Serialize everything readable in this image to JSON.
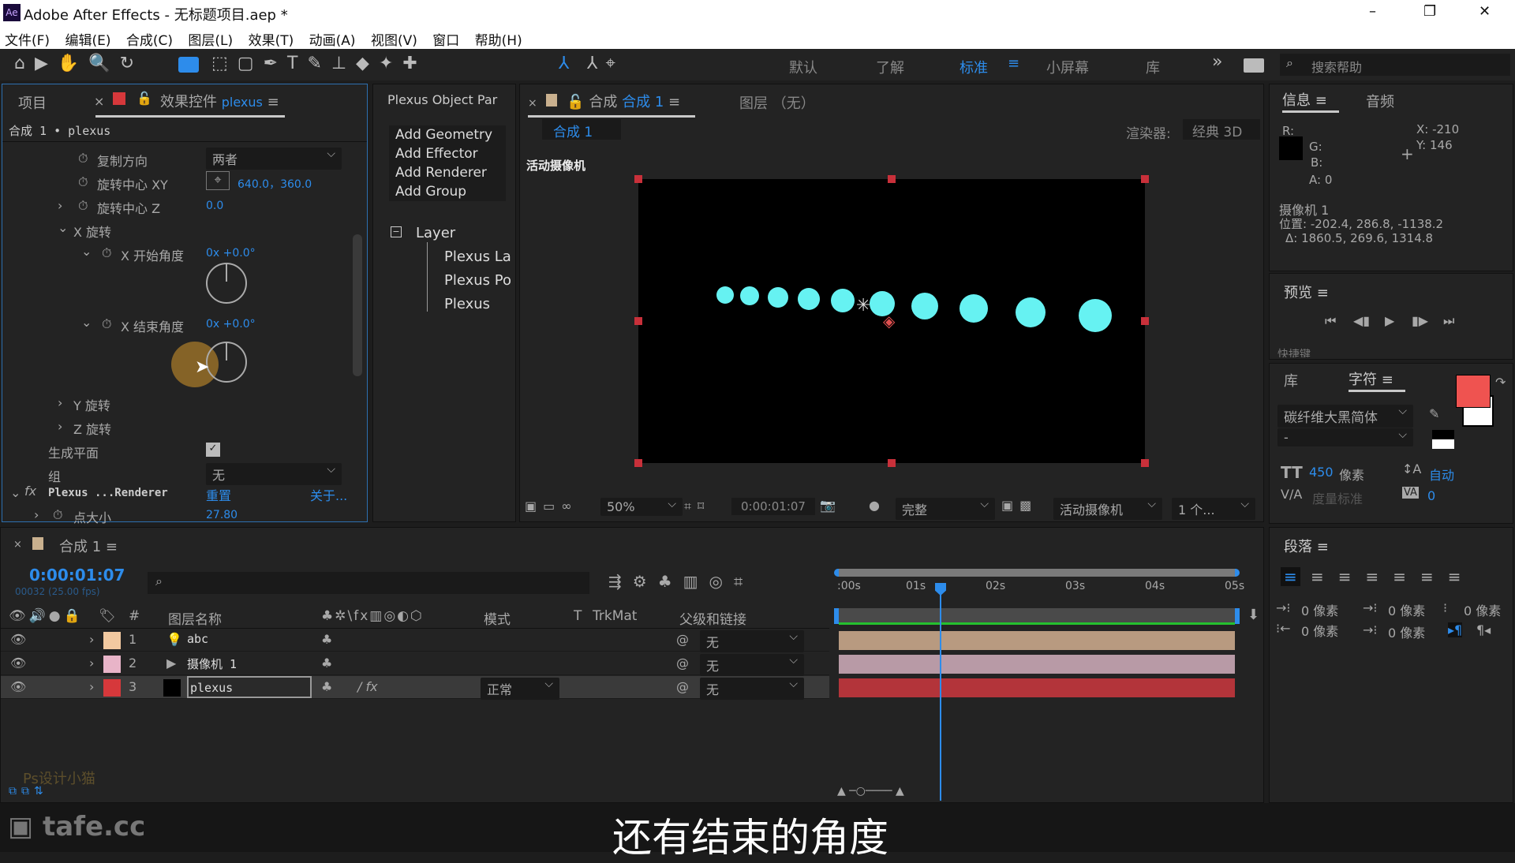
{
  "window": {
    "title": "Adobe After Effects - 无标题项目.aep *",
    "app_icon": "Ae",
    "minimize": "–",
    "restore": "❐",
    "close": "✕"
  },
  "menu": [
    "文件(F)",
    "编辑(E)",
    "合成(C)",
    "图层(L)",
    "效果(T)",
    "动画(A)",
    "视图(V)",
    "窗口",
    "帮助(H)"
  ],
  "workspaces": {
    "items": [
      "默认",
      "了解",
      "标准",
      "小屏幕",
      "库"
    ],
    "active": "标准",
    "more": "»",
    "search_placeholder": "搜索帮助"
  },
  "effect_panel": {
    "tab_project": "项目",
    "tab_effects": "效果控件",
    "layer": "plexus",
    "breadcrumb": "合成 1 • plexus",
    "props": [
      {
        "label": "复制方向",
        "value": "两者"
      },
      {
        "label": "旋转中心 XY",
        "value": "640.0，360.0"
      },
      {
        "label": "旋转中心 Z",
        "value": "0.0"
      },
      {
        "label": "X 旋转"
      },
      {
        "label": "X 开始角度",
        "value": "0x +0.0°"
      },
      {
        "label": "X 结束角度",
        "value": "0x +0.0°"
      },
      {
        "label": "Y 旋转"
      },
      {
        "label": "Z 旋转"
      },
      {
        "label": "生成平面",
        "checked": true
      },
      {
        "label": "组",
        "value": "无"
      }
    ],
    "renderer": {
      "label": "Plexus ...Renderer",
      "reset": "重置",
      "about": "关于..."
    },
    "point_size": {
      "label": "点大小",
      "value": "27.80"
    }
  },
  "plexus_panel": {
    "title": "Plexus Object Par",
    "buttons": [
      "Add Geometry",
      "Add Effector",
      "Add Renderer",
      "Add Group"
    ],
    "tree_root": "Layer",
    "tree_items": [
      "Plexus La",
      "Plexus Po",
      "Plexus"
    ]
  },
  "comp_panel": {
    "tab_prefix": "合成",
    "tab_name": "合成 1",
    "layer_tab": "图层 （无）",
    "breadcrumb": "合成 1",
    "renderer_label": "渲染器:",
    "renderer_value": "经典 3D",
    "view_label": "活动摄像机",
    "footer": {
      "zoom": "50%",
      "time": "0:00:01:07",
      "quality": "完整",
      "camera": "活动摄像机",
      "views": "1 个..."
    },
    "dot_color": "#66f2f2"
  },
  "info_panel": {
    "tab": "信息",
    "tab_audio": "音频",
    "r": "R:",
    "g": "G:",
    "b": "B:",
    "a": "A:  0",
    "x": "X: -210",
    "y": "Y: 146",
    "camera": "摄像机 1",
    "position": "位置: -202.4, 286.8, -1138.2",
    "delta": "Δ: 1860.5, 269.6, 1314.8"
  },
  "preview_panel": {
    "title": "预览",
    "shortcut": "快捷键"
  },
  "character_panel": {
    "tab_lib": "库",
    "tab": "字符",
    "font": "碳纤维大黑简体",
    "style": "-",
    "size": "450",
    "size_unit": "像素",
    "leading": "自动",
    "kerning": "度量标准",
    "tracking": "0",
    "fill_color": "#ef5350"
  },
  "paragraph_panel": {
    "title": "段落",
    "indents": [
      "0 像素",
      "0 像素",
      "0 像素",
      "0 像素",
      "0 像素"
    ]
  },
  "timeline": {
    "tab": "合成 1",
    "timecode": "0:00:01:07",
    "frames": "00032 (25.00 fps)",
    "search_placeholder": "",
    "headers": {
      "name": "图层名称",
      "mode": "模式",
      "t": "T",
      "trkmat": "TrkMat",
      "parent": "父级和链接",
      "num": "#"
    },
    "ruler": [
      ":00s",
      "01s",
      "02s",
      "03s",
      "04s",
      "05s"
    ],
    "layers": [
      {
        "num": "1",
        "name": "abc",
        "type": "text",
        "label_color": "#f2c9a0",
        "parent": "无",
        "bar_color": "#b89a80"
      },
      {
        "num": "2",
        "name": "摄像机 1",
        "type": "camera",
        "label_color": "#e8b4c8",
        "parent": "无",
        "bar_color": "#b89aa6"
      },
      {
        "num": "3",
        "name": "plexus",
        "type": "solid",
        "label_color": "#d6383b",
        "mode": "正常",
        "parent": "无",
        "bar_color": "#b3343a"
      }
    ]
  },
  "subtitle": "还有结束的角度",
  "watermark": "tafe.cc",
  "watermark2": "Ps设计小猫"
}
